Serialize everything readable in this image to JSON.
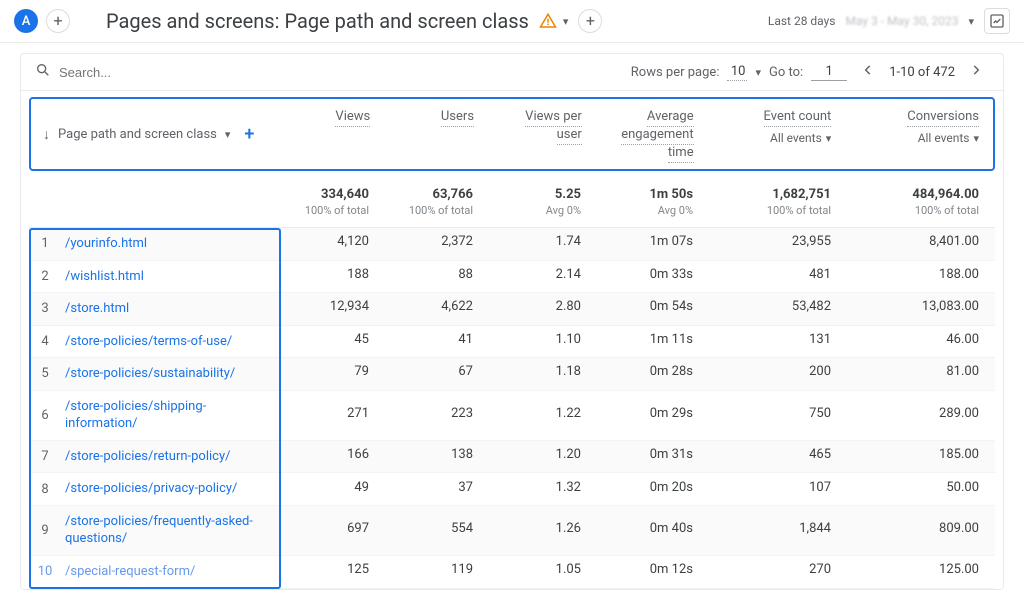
{
  "header": {
    "avatar_letter": "A",
    "title": "Pages and screens: Page path and screen class",
    "date_label": "Last 28 days",
    "date_range": "May 3 - May 30, 2023"
  },
  "toolbar": {
    "search_placeholder": "Search...",
    "rows_label": "Rows per page:",
    "rows_value": "10",
    "goto_label": "Go to:",
    "goto_value": "1",
    "range_text": "1-10 of 472"
  },
  "columns": {
    "dimension": "Page path and screen class",
    "views": "Views",
    "users": "Users",
    "vpu_line1": "Views per",
    "vpu_line2": "user",
    "aet_line1": "Average",
    "aet_line2": "engagement",
    "aet_line3": "time",
    "event_count": "Event count",
    "event_sub": "All events",
    "conversions": "Conversions",
    "conv_sub": "All events"
  },
  "totals": {
    "views": "334,640",
    "views_sub": "100% of total",
    "users": "63,766",
    "users_sub": "100% of total",
    "vpu": "5.25",
    "vpu_sub": "Avg 0%",
    "aet": "1m 50s",
    "aet_sub": "Avg 0%",
    "ec": "1,682,751",
    "ec_sub": "100% of total",
    "conv": "484,964.00",
    "conv_sub": "100% of total"
  },
  "rows": [
    {
      "idx": "1",
      "path": "/yourinfo.html",
      "views": "4,120",
      "users": "2,372",
      "vpu": "1.74",
      "aet": "1m 07s",
      "ec": "23,955",
      "conv": "8,401.00"
    },
    {
      "idx": "2",
      "path": "/wishlist.html",
      "views": "188",
      "users": "88",
      "vpu": "2.14",
      "aet": "0m 33s",
      "ec": "481",
      "conv": "188.00"
    },
    {
      "idx": "3",
      "path": "/store.html",
      "views": "12,934",
      "users": "4,622",
      "vpu": "2.80",
      "aet": "0m 54s",
      "ec": "53,482",
      "conv": "13,083.00"
    },
    {
      "idx": "4",
      "path": "/store-policies/terms-of-use/",
      "views": "45",
      "users": "41",
      "vpu": "1.10",
      "aet": "1m 11s",
      "ec": "131",
      "conv": "46.00"
    },
    {
      "idx": "5",
      "path": "/store-policies/sustainability/",
      "views": "79",
      "users": "67",
      "vpu": "1.18",
      "aet": "0m 28s",
      "ec": "200",
      "conv": "81.00"
    },
    {
      "idx": "6",
      "path": "/store-policies/shipping-information/",
      "views": "271",
      "users": "223",
      "vpu": "1.22",
      "aet": "0m 29s",
      "ec": "750",
      "conv": "289.00"
    },
    {
      "idx": "7",
      "path": "/store-policies/return-policy/",
      "views": "166",
      "users": "138",
      "vpu": "1.20",
      "aet": "0m 31s",
      "ec": "465",
      "conv": "185.00"
    },
    {
      "idx": "8",
      "path": "/store-policies/privacy-policy/",
      "views": "49",
      "users": "37",
      "vpu": "1.32",
      "aet": "0m 20s",
      "ec": "107",
      "conv": "50.00"
    },
    {
      "idx": "9",
      "path": "/store-policies/frequently-asked-questions/",
      "views": "697",
      "users": "554",
      "vpu": "1.26",
      "aet": "0m 40s",
      "ec": "1,844",
      "conv": "809.00"
    },
    {
      "idx": "10",
      "path": "/special-request-form/",
      "views": "125",
      "users": "119",
      "vpu": "1.05",
      "aet": "0m 12s",
      "ec": "270",
      "conv": "125.00"
    }
  ]
}
